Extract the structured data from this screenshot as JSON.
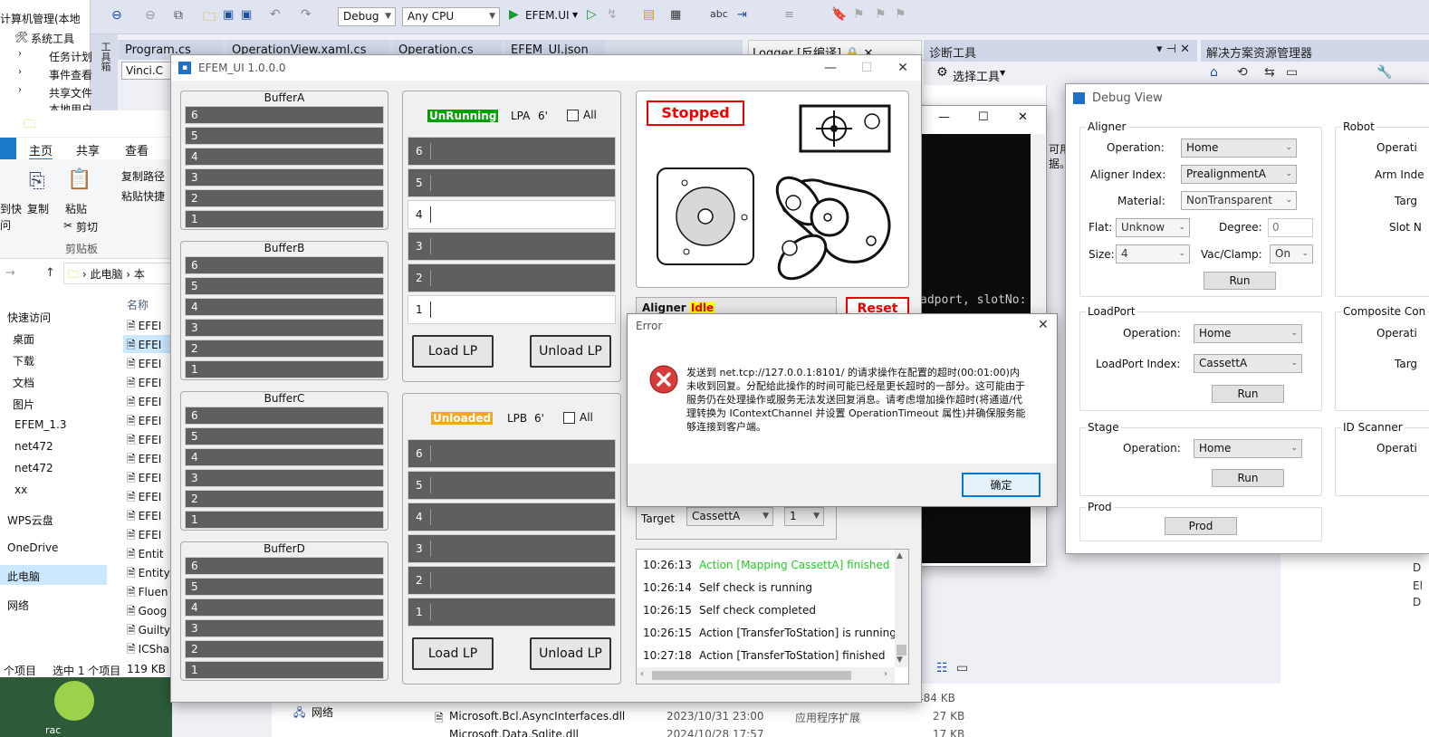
{
  "vs": {
    "config": "Debug",
    "platform": "Any CPU",
    "start_project": "EFEM.UI",
    "doc_tabs": [
      "Program.cs",
      "OperationView.xaml.cs",
      "Operation.cs",
      "EFEM_UI.json"
    ],
    "logger_tab": "Logger [反编译]",
    "diag_title": "诊断工具",
    "diag_select_tool": "选择工具",
    "solution_title": "解决方案资源管理器"
  },
  "mmc": {
    "title": "计算机管理(本地",
    "items": [
      "系统工具",
      "任务计划",
      "事件查看",
      "共享文件",
      "本地用户"
    ]
  },
  "explorer": {
    "ribbon_tabs": [
      "主页",
      "共享",
      "查看"
    ],
    "active_tab": "主页",
    "tools": [
      "复制",
      "粘贴",
      "复制路径",
      "粘贴快捷",
      "剪切"
    ],
    "group_label": "剪贴板",
    "pin_label": "到快",
    "pin_label2": "问",
    "breadcrumb": [
      "此电脑",
      "本"
    ],
    "column_name": "名称",
    "nav": [
      "快速访问",
      "桌面",
      "下载",
      "文档",
      "图片",
      "EFEM_1.3",
      "net472",
      "net472",
      "xx",
      "WPS云盘",
      "OneDrive",
      "此电脑",
      "网络"
    ],
    "files": [
      "EFEI",
      "EFEI",
      "EFEI",
      "EFEI",
      "EFEI",
      "EFEI",
      "EFEI",
      "EFEI",
      "EFEI",
      "EFEI",
      "EFEI",
      "EFEI",
      "Entit",
      "Entity",
      "Fluen",
      "Goog",
      "Guilty",
      "ICSha"
    ],
    "status_count": "个项目",
    "status_selected": "选中 1 个项目",
    "status_size": "119 KB",
    "bottom_nav": "网络",
    "bottom_file": "Microsoft.Bcl.AsyncInterfaces.dll",
    "bottom_date": "2023/10/31 23:00",
    "bottom_type": "应用程序扩展",
    "bottom_size": "27 KB",
    "bottom_size2": "484 KB",
    "bottom_file2": "Microsoft.Data.Sqlite.dll",
    "bottom_date2": "2024/10/28 17:57",
    "bottom_size3": "17 KB",
    "right_list": [
      "D",
      "El",
      "D"
    ],
    "bottom_left_label": "rac"
  },
  "vinci": {
    "tab": "Vinci.C"
  },
  "efem": {
    "title": "EFEM_UI 1.0.0.0",
    "buffers": [
      {
        "name": "BufferA",
        "slots": [
          "6",
          "5",
          "4",
          "3",
          "2",
          "1"
        ]
      },
      {
        "name": "BufferB",
        "slots": [
          "6",
          "5",
          "4",
          "3",
          "2",
          "1"
        ]
      },
      {
        "name": "BufferC",
        "slots": [
          "6",
          "5",
          "4",
          "3",
          "2",
          "1"
        ]
      },
      {
        "name": "BufferD",
        "slots": [
          "6",
          "5",
          "4",
          "3",
          "2",
          "1"
        ]
      }
    ],
    "lpa": {
      "status": "UnRunning",
      "status_color": "#00a000",
      "label": "LPA",
      "size": "6'",
      "all_label": "All",
      "slots": [
        {
          "num": "6",
          "filled": true
        },
        {
          "num": "5",
          "filled": true
        },
        {
          "num": "4",
          "filled": false
        },
        {
          "num": "3",
          "filled": true
        },
        {
          "num": "2",
          "filled": true
        },
        {
          "num": "1",
          "filled": false
        }
      ],
      "load_label": "Load LP",
      "unload_label": "Unload LP"
    },
    "lpb": {
      "status": "Unloaded",
      "status_color": "#f5a623",
      "label": "LPB",
      "size": "6'",
      "all_label": "All",
      "slots": [
        {
          "num": "6",
          "filled": true
        },
        {
          "num": "5",
          "filled": true
        },
        {
          "num": "4",
          "filled": true
        },
        {
          "num": "3",
          "filled": true
        },
        {
          "num": "2",
          "filled": true
        },
        {
          "num": "1",
          "filled": true
        }
      ],
      "load_label": "Load LP",
      "unload_label": "Unload LP"
    },
    "stopped": "Stopped",
    "aligner_label": "Aligner",
    "aligner_state": "Idle",
    "reset_label": "Reset",
    "target_label": "Target",
    "target_value": "CassettA",
    "target_slot": "1",
    "log": [
      {
        "time": "10:26:13",
        "msg": "Action [Mapping CassettA] finished",
        "color": "#22cc22"
      },
      {
        "time": "10:26:14",
        "msg": "Self check is running",
        "color": "#111111"
      },
      {
        "time": "10:26:15",
        "msg": "Self check completed",
        "color": "#111111"
      },
      {
        "time": "10:26:15",
        "msg": "Action [TransferToStation] is running",
        "color": "#111111"
      },
      {
        "time": "10:27:18",
        "msg": "Action [TransferToStation] finished",
        "color": "#111111"
      }
    ]
  },
  "console": {
    "text": "adport, slotNo:",
    "side1": "可用",
    "side2": "据。"
  },
  "error": {
    "title": "Error",
    "message": "发送到 net.tcp://127.0.0.1:8101/ 的请求操作在配置的超时(00:01:00)内未收到回复。分配给此操作的时间可能已经是更长超时的一部分。这可能由于服务仍在处理操作或服务无法发送回复消息。请考虑增加操作超时(将通道/代理转换为 IContextChannel 并设置 OperationTimeout 属性)并确保服务能够连接到客户端。",
    "ok": "确定"
  },
  "debug": {
    "title": "Debug View",
    "aligner": {
      "title": "Aligner",
      "operation_label": "Operation:",
      "operation": "Home",
      "index_label": "Aligner Index:",
      "index": "PrealignmentA",
      "material_label": "Material:",
      "material": "NonTransparent",
      "flat_label": "Flat:",
      "flat": "Unknow",
      "degree_label": "Degree:",
      "degree": "0",
      "size_label": "Size:",
      "size": "4",
      "vac_label": "Vac/Clamp:",
      "vac": "On",
      "run": "Run"
    },
    "loadport": {
      "title": "LoadPort",
      "operation_label": "Operation:",
      "operation": "Home",
      "index_label": "LoadPort Index:",
      "index": "CassettA",
      "run": "Run"
    },
    "stage": {
      "title": "Stage",
      "operation_label": "Operation:",
      "operation": "Home",
      "run": "Run"
    },
    "prod": {
      "title": "Prod",
      "button": "Prod"
    },
    "robot": {
      "title": "Robot",
      "operation": "Operati",
      "arm": "Arm Inde",
      "target": "Targ",
      "slot": "Slot N"
    },
    "composite": {
      "title": "Composite Con",
      "operation": "Operati",
      "target": "Targ"
    },
    "idscanner": {
      "title": "ID Scanner",
      "operation": "Operati"
    }
  }
}
